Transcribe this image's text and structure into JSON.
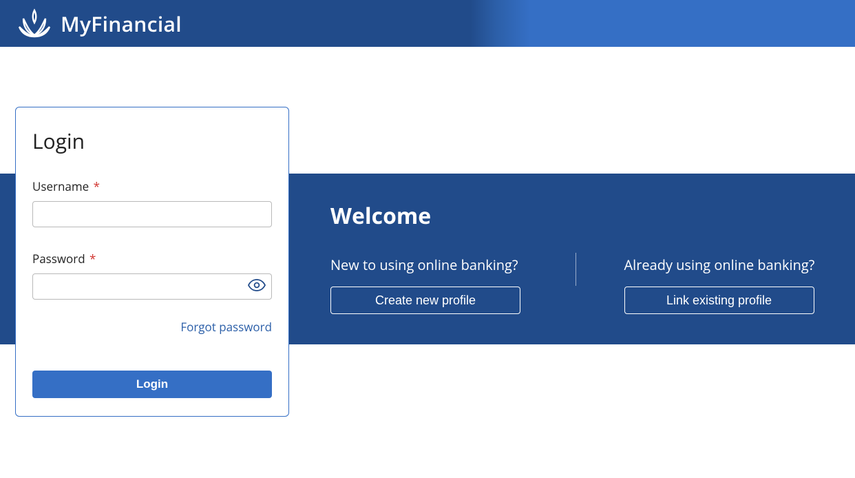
{
  "header": {
    "brand": "MyFinancial"
  },
  "login": {
    "title": "Login",
    "username_label": "Username",
    "password_label": "Password",
    "username_value": "",
    "password_value": "",
    "required_mark": "*",
    "forgot_label": "Forgot password",
    "login_button": "Login"
  },
  "welcome": {
    "title": "Welcome",
    "new_question": "New to using online banking?",
    "create_button": "Create new profile",
    "existing_question": "Already using online banking?",
    "link_button": "Link existing profile"
  }
}
